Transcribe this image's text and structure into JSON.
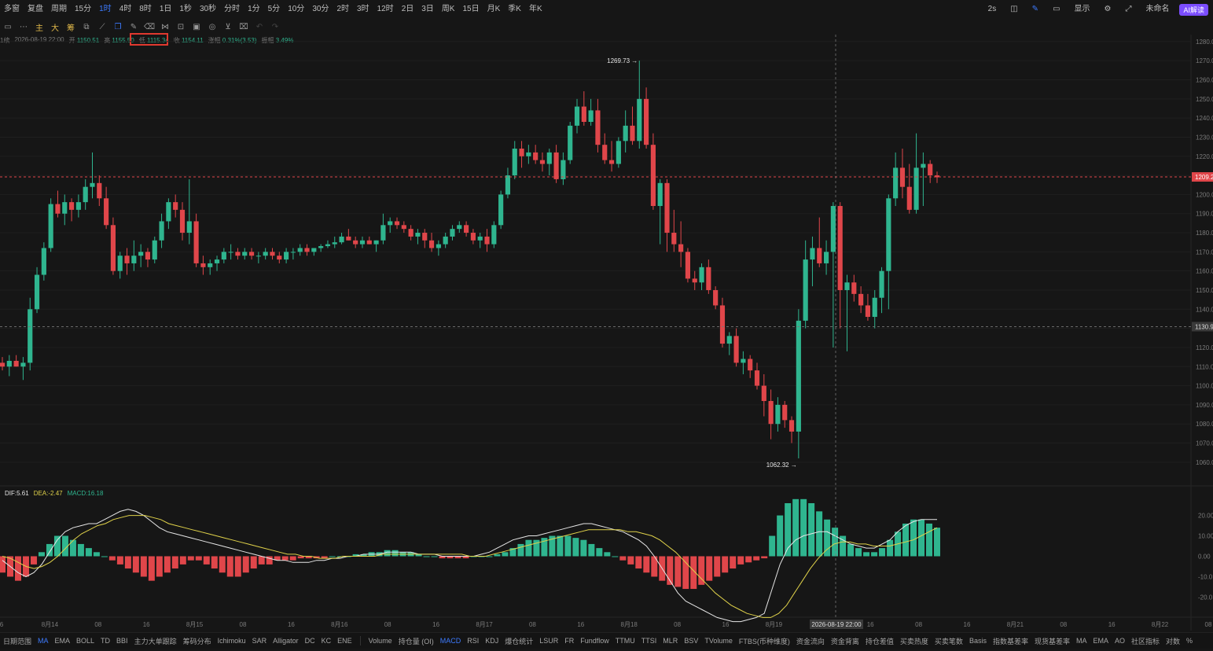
{
  "toolbar": {
    "items": [
      "多窗",
      "复盘",
      "周期",
      "15分",
      "1时",
      "4时",
      "8时",
      "1日",
      "1秒",
      "30秒",
      "分时",
      "1分",
      "5分",
      "10分",
      "30分",
      "2时",
      "3时",
      "12时",
      "2日",
      "3日",
      "周K",
      "15日",
      "月K",
      "季K",
      "年K"
    ],
    "active_index": 4,
    "right": {
      "refresh": "2s",
      "display": "显示",
      "name": "未命名",
      "ai": "AI解读"
    }
  },
  "drawbar": {
    "labels": [
      "主",
      "大",
      "筹"
    ]
  },
  "ohlc": {
    "prefix": "1续",
    "datetime": "2026-08-19 22:00",
    "open_label": "开",
    "open": "1150.51",
    "high_label": "高",
    "high": "1155.50",
    "low_label": "低",
    "low": "1115.34",
    "close_label": "收",
    "close": "1154.11",
    "change_label": "涨幅",
    "change": "0.31%(3.53)",
    "amp_label": "振幅",
    "amp": "3.49%"
  },
  "macd_legend": {
    "dif": "DIF:5.61",
    "dea": "DEA:-2.47",
    "macd": "MACD:16.18"
  },
  "chart_data": {
    "type": "candlestick",
    "price_axis": [
      "1280.0",
      "1270.0",
      "1260.0",
      "1250.0",
      "1240.0",
      "1230.0",
      "1220.0",
      "1210.0",
      "1200.0",
      "1190.0",
      "1180.0",
      "1170.0",
      "1160.0",
      "1150.0",
      "1140.0",
      "1130.0",
      "1120.0",
      "1110.0",
      "1100.0",
      "1090.0",
      "1080.0",
      "1070.0",
      "1060.0"
    ],
    "price_range": [
      1055,
      1282
    ],
    "current_price_label": "1209.2",
    "crosshair_price_label": "1130.9",
    "high_marker": "1269.73",
    "low_marker": "1062.32",
    "macd_axis": [
      "20.00",
      "10.00",
      "0.00",
      "-10.0",
      "-20.0"
    ],
    "macd_range": [
      -26,
      26
    ],
    "time_axis": [
      "6",
      "8月14",
      "08",
      "16",
      "8月15",
      "08",
      "16",
      "8月16",
      "08",
      "16",
      "8月17",
      "08",
      "16",
      "8月18",
      "08",
      "16",
      "8月19",
      "08",
      "16",
      "08",
      "16",
      "8月21",
      "08",
      "16",
      "8月22",
      "08"
    ],
    "crosshair_time_label": "2026-08-19 22:00",
    "candles": [
      [
        1112,
        1115,
        1108,
        1110
      ],
      [
        1110,
        1116,
        1105,
        1113
      ],
      [
        1113,
        1116,
        1110,
        1110
      ],
      [
        1110,
        1115,
        1103,
        1112
      ],
      [
        1112,
        1146,
        1108,
        1140
      ],
      [
        1140,
        1162,
        1138,
        1158
      ],
      [
        1158,
        1175,
        1155,
        1172
      ],
      [
        1172,
        1198,
        1170,
        1195
      ],
      [
        1195,
        1202,
        1188,
        1190
      ],
      [
        1190,
        1200,
        1184,
        1196
      ],
      [
        1196,
        1198,
        1186,
        1192
      ],
      [
        1192,
        1200,
        1188,
        1196
      ],
      [
        1196,
        1208,
        1192,
        1204
      ],
      [
        1204,
        1222,
        1198,
        1206
      ],
      [
        1206,
        1210,
        1194,
        1198
      ],
      [
        1198,
        1204,
        1182,
        1184
      ],
      [
        1184,
        1188,
        1158,
        1160
      ],
      [
        1160,
        1170,
        1156,
        1168
      ],
      [
        1168,
        1172,
        1158,
        1164
      ],
      [
        1164,
        1176,
        1160,
        1168
      ],
      [
        1168,
        1174,
        1162,
        1170
      ],
      [
        1170,
        1172,
        1162,
        1166
      ],
      [
        1166,
        1178,
        1164,
        1176
      ],
      [
        1176,
        1190,
        1172,
        1186
      ],
      [
        1186,
        1198,
        1182,
        1196
      ],
      [
        1196,
        1200,
        1188,
        1192
      ],
      [
        1192,
        1196,
        1176,
        1180
      ],
      [
        1180,
        1208,
        1174,
        1186
      ],
      [
        1186,
        1190,
        1162,
        1164
      ],
      [
        1164,
        1168,
        1158,
        1162
      ],
      [
        1162,
        1166,
        1158,
        1164
      ],
      [
        1164,
        1168,
        1160,
        1166
      ],
      [
        1166,
        1172,
        1164,
        1170
      ],
      [
        1170,
        1174,
        1166,
        1170
      ],
      [
        1170,
        1172,
        1166,
        1168
      ],
      [
        1168,
        1172,
        1166,
        1170
      ],
      [
        1170,
        1172,
        1166,
        1168
      ],
      [
        1168,
        1170,
        1164,
        1168
      ],
      [
        1168,
        1172,
        1166,
        1170
      ],
      [
        1170,
        1172,
        1166,
        1168
      ],
      [
        1168,
        1170,
        1164,
        1166
      ],
      [
        1166,
        1172,
        1164,
        1170
      ],
      [
        1170,
        1172,
        1166,
        1170
      ],
      [
        1170,
        1174,
        1168,
        1172
      ],
      [
        1172,
        1174,
        1168,
        1170
      ],
      [
        1170,
        1172,
        1168,
        1172
      ],
      [
        1172,
        1174,
        1170,
        1173
      ],
      [
        1173,
        1176,
        1172,
        1174
      ],
      [
        1174,
        1178,
        1172,
        1175
      ],
      [
        1175,
        1180,
        1174,
        1178
      ],
      [
        1178,
        1182,
        1176,
        1176
      ],
      [
        1176,
        1178,
        1172,
        1174
      ],
      [
        1174,
        1178,
        1172,
        1176
      ],
      [
        1176,
        1178,
        1174,
        1174
      ],
      [
        1174,
        1176,
        1170,
        1176
      ],
      [
        1176,
        1190,
        1174,
        1184
      ],
      [
        1184,
        1188,
        1180,
        1186
      ],
      [
        1186,
        1188,
        1182,
        1184
      ],
      [
        1184,
        1186,
        1180,
        1182
      ],
      [
        1182,
        1184,
        1176,
        1178
      ],
      [
        1178,
        1182,
        1174,
        1180
      ],
      [
        1180,
        1182,
        1172,
        1176
      ],
      [
        1176,
        1180,
        1170,
        1172
      ],
      [
        1172,
        1176,
        1168,
        1174
      ],
      [
        1174,
        1180,
        1172,
        1178
      ],
      [
        1178,
        1184,
        1176,
        1182
      ],
      [
        1182,
        1186,
        1180,
        1184
      ],
      [
        1184,
        1186,
        1178,
        1180
      ],
      [
        1180,
        1182,
        1174,
        1176
      ],
      [
        1176,
        1180,
        1172,
        1178
      ],
      [
        1178,
        1182,
        1170,
        1174
      ],
      [
        1174,
        1186,
        1172,
        1184
      ],
      [
        1184,
        1202,
        1182,
        1200
      ],
      [
        1200,
        1214,
        1198,
        1210
      ],
      [
        1210,
        1228,
        1208,
        1224
      ],
      [
        1224,
        1228,
        1214,
        1220
      ],
      [
        1220,
        1226,
        1216,
        1222
      ],
      [
        1222,
        1226,
        1216,
        1218
      ],
      [
        1218,
        1222,
        1212,
        1216
      ],
      [
        1216,
        1224,
        1210,
        1222
      ],
      [
        1222,
        1226,
        1206,
        1208
      ],
      [
        1208,
        1222,
        1205,
        1218
      ],
      [
        1218,
        1238,
        1216,
        1236
      ],
      [
        1236,
        1250,
        1232,
        1246
      ],
      [
        1246,
        1254,
        1236,
        1238
      ],
      [
        1238,
        1250,
        1236,
        1244
      ],
      [
        1244,
        1250,
        1222,
        1226
      ],
      [
        1226,
        1232,
        1216,
        1218
      ],
      [
        1218,
        1228,
        1212,
        1216
      ],
      [
        1216,
        1230,
        1214,
        1228
      ],
      [
        1228,
        1244,
        1222,
        1236
      ],
      [
        1236,
        1246,
        1226,
        1228
      ],
      [
        1228,
        1270,
        1224,
        1250
      ],
      [
        1250,
        1256,
        1224,
        1226
      ],
      [
        1226,
        1232,
        1192,
        1194
      ],
      [
        1194,
        1208,
        1174,
        1206
      ],
      [
        1206,
        1208,
        1170,
        1180
      ],
      [
        1180,
        1192,
        1170,
        1174
      ],
      [
        1174,
        1186,
        1162,
        1170
      ],
      [
        1170,
        1172,
        1154,
        1156
      ],
      [
        1156,
        1160,
        1150,
        1154
      ],
      [
        1154,
        1164,
        1150,
        1162
      ],
      [
        1162,
        1166,
        1148,
        1150
      ],
      [
        1150,
        1152,
        1140,
        1142
      ],
      [
        1142,
        1146,
        1120,
        1122
      ],
      [
        1122,
        1128,
        1116,
        1126
      ],
      [
        1126,
        1130,
        1110,
        1112
      ],
      [
        1112,
        1118,
        1106,
        1114
      ],
      [
        1114,
        1116,
        1104,
        1108
      ],
      [
        1108,
        1112,
        1098,
        1100
      ],
      [
        1100,
        1106,
        1084,
        1092
      ],
      [
        1092,
        1098,
        1072,
        1080
      ],
      [
        1080,
        1094,
        1076,
        1090
      ],
      [
        1090,
        1092,
        1078,
        1082
      ],
      [
        1082,
        1084,
        1070,
        1076
      ],
      [
        1076,
        1140,
        1062,
        1134
      ],
      [
        1134,
        1176,
        1130,
        1166
      ],
      [
        1166,
        1178,
        1152,
        1172
      ],
      [
        1172,
        1188,
        1162,
        1164
      ],
      [
        1164,
        1176,
        1158,
        1170
      ],
      [
        1170,
        1196,
        1120,
        1194
      ],
      [
        1194,
        1196,
        1130,
        1150
      ],
      [
        1150,
        1158,
        1118,
        1154
      ],
      [
        1154,
        1158,
        1144,
        1148
      ],
      [
        1148,
        1152,
        1138,
        1142
      ],
      [
        1142,
        1148,
        1134,
        1136
      ],
      [
        1136,
        1150,
        1130,
        1146
      ],
      [
        1146,
        1162,
        1138,
        1160
      ],
      [
        1160,
        1200,
        1140,
        1198
      ],
      [
        1198,
        1222,
        1194,
        1214
      ],
      [
        1214,
        1224,
        1198,
        1204
      ],
      [
        1204,
        1216,
        1190,
        1192
      ],
      [
        1192,
        1232,
        1190,
        1214
      ],
      [
        1214,
        1222,
        1194,
        1216
      ],
      [
        1216,
        1218,
        1206,
        1210
      ],
      [
        1210,
        1212,
        1206,
        1209
      ]
    ],
    "dif": [
      -2,
      -5,
      -8,
      -10,
      -8,
      -4,
      2,
      8,
      12,
      14,
      15,
      16,
      16,
      18,
      20,
      22,
      23,
      22,
      20,
      17,
      14,
      12,
      11,
      10,
      9,
      8,
      7,
      6,
      5,
      4,
      3,
      2,
      1,
      0,
      -1,
      -2,
      -2,
      -3,
      -3,
      -3,
      -2,
      -2,
      -1,
      -1,
      0,
      0,
      1,
      1,
      1,
      2,
      2,
      2,
      2,
      1,
      1,
      1,
      0,
      0,
      0,
      0,
      0,
      1,
      2,
      4,
      6,
      8,
      9,
      10,
      10,
      11,
      12,
      13,
      14,
      15,
      16,
      16,
      15,
      14,
      13,
      12,
      10,
      8,
      5,
      0,
      -6,
      -12,
      -18,
      -22,
      -24,
      -26,
      -28,
      -30,
      -31,
      -32,
      -32,
      -31,
      -30,
      -28,
      -16,
      -4,
      4,
      8,
      10,
      11,
      12,
      12,
      10,
      8,
      6,
      5,
      4,
      4,
      6,
      8,
      12,
      15,
      17,
      18,
      18,
      18
    ],
    "dea": [
      0,
      -1,
      -3,
      -5,
      -6,
      -5,
      -3,
      0,
      4,
      8,
      11,
      13,
      15,
      16,
      18,
      19,
      20,
      20,
      20,
      19,
      18,
      16,
      15,
      14,
      13,
      12,
      11,
      10,
      9,
      8,
      7,
      6,
      5,
      4,
      3,
      2,
      1,
      1,
      0,
      0,
      -1,
      -1,
      -1,
      0,
      0,
      0,
      0,
      0,
      1,
      1,
      1,
      1,
      1,
      1,
      1,
      1,
      1,
      1,
      1,
      0,
      0,
      0,
      1,
      2,
      3,
      4,
      5,
      6,
      7,
      8,
      9,
      10,
      11,
      12,
      13,
      13,
      13,
      13,
      13,
      12,
      12,
      11,
      10,
      8,
      5,
      2,
      -2,
      -6,
      -10,
      -14,
      -18,
      -21,
      -24,
      -26,
      -28,
      -29,
      -30,
      -30,
      -28,
      -24,
      -18,
      -12,
      -6,
      -1,
      3,
      6,
      7,
      7,
      6,
      6,
      5,
      5,
      5,
      6,
      7,
      8,
      10,
      12,
      14
    ],
    "hist": [
      -8,
      -10,
      -12,
      -10,
      -4,
      2,
      6,
      10,
      10,
      8,
      6,
      4,
      2,
      0,
      -2,
      -4,
      -6,
      -8,
      -10,
      -12,
      -10,
      -8,
      -6,
      -4,
      -2,
      -2,
      -4,
      -6,
      -8,
      -10,
      -10,
      -8,
      -6,
      -4,
      -4,
      -2,
      -2,
      -2,
      -1,
      -1,
      -1,
      -1,
      0,
      0,
      0,
      1,
      1,
      2,
      2,
      3,
      3,
      2,
      2,
      1,
      0,
      0,
      -1,
      -1,
      -1,
      -1,
      0,
      0,
      0,
      1,
      2,
      4,
      6,
      8,
      8,
      9,
      10,
      10,
      10,
      9,
      8,
      6,
      4,
      2,
      0,
      -2,
      -4,
      -6,
      -8,
      -10,
      -12,
      -14,
      -15,
      -16,
      -16,
      -14,
      -12,
      -10,
      -8,
      -6,
      -4,
      -3,
      -2,
      -1,
      10,
      20,
      26,
      28,
      28,
      26,
      22,
      18,
      14,
      10,
      6,
      4,
      2,
      2,
      4,
      8,
      12,
      16,
      18,
      18,
      16,
      14
    ]
  },
  "bottombar": {
    "left": [
      "日期范围",
      "MA",
      "EMA",
      "BOLL",
      "TD",
      "BBI",
      "主力大单跟踪",
      "筹码分布",
      "Ichimoku",
      "SAR",
      "Alligator",
      "DC",
      "KC",
      "ENE"
    ],
    "left_active": 1,
    "right": [
      "Volume",
      "持仓量 (OI)",
      "MACD",
      "RSI",
      "KDJ",
      "爆仓统计",
      "LSUR",
      "FR",
      "Fundflow",
      "TTMU",
      "TTSI",
      "MLR",
      "BSV",
      "TVolume",
      "FTBS(币种维度)",
      "资金流向",
      "资金背离",
      "持仓差值",
      "买卖热度",
      "买卖笔数",
      "Basis",
      "指数基差率",
      "现货基差率",
      "MA",
      "EMA",
      "AO",
      "社区指标",
      "对数",
      "%"
    ],
    "right_active": 2
  }
}
